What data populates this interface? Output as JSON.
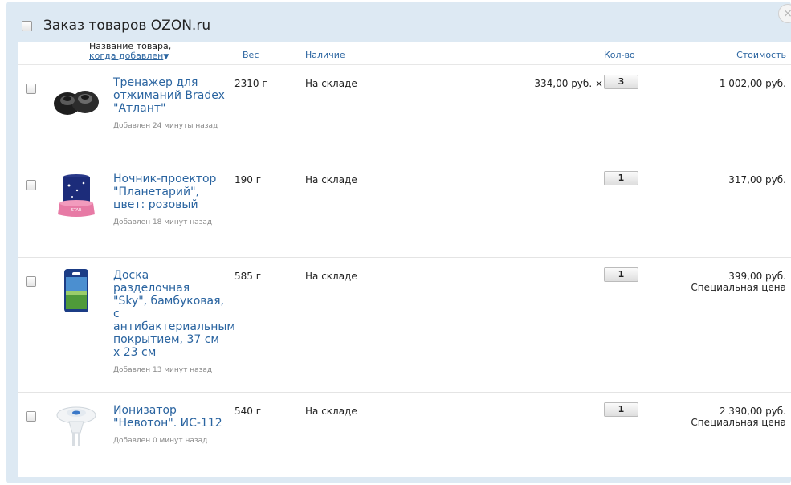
{
  "title": "Заказ товаров OZON.ru",
  "columns": {
    "name_line1": "Название товара,",
    "name_line2": "когда добавлен",
    "sort_arrow": "▼",
    "weight": "Вес",
    "availability": "Наличие",
    "quantity": "Кол-во",
    "cost": "Стоимость"
  },
  "close_icon": "×",
  "items": [
    {
      "name": "Тренажер для отжиманий Bradex \"Атлант\"",
      "added": "Добавлен 24 минуты назад",
      "weight": "2310 г",
      "availability": "На складе",
      "unit_price": "334,00 руб. ×",
      "quantity": "3",
      "cost": "1 002,00 руб.",
      "note": ""
    },
    {
      "name": "Ночник-проектор \"Планетарий\", цвет: розовый",
      "added": "Добавлен 18 минут назад",
      "weight": "190 г",
      "availability": "На складе",
      "unit_price": "",
      "quantity": "1",
      "cost": "317,00 руб.",
      "note": ""
    },
    {
      "name": "Доска разделочная \"Sky\", бамбуковая, с антибактериальным покрытием, 37 см х 23 см",
      "added": "Добавлен 13 минут назад",
      "weight": "585 г",
      "availability": "На складе",
      "unit_price": "",
      "quantity": "1",
      "cost": "399,00 руб.",
      "note": "Специальная цена"
    },
    {
      "name": "Ионизатор \"Невотон\". ИС-112",
      "added": "Добавлен 0 минут назад",
      "weight": "540 г",
      "availability": "На складе",
      "unit_price": "",
      "quantity": "1",
      "cost": "2 390,00 руб.",
      "note": "Специальная цена"
    }
  ],
  "colors": {
    "panel_bg": "#dde9f3",
    "link": "#2a64a0"
  }
}
